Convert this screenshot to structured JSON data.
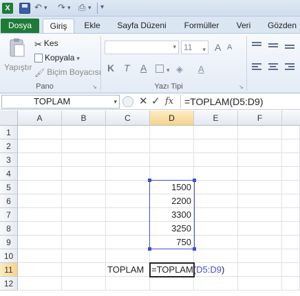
{
  "tabs": [
    "Dosya",
    "Giriş",
    "Ekle",
    "Sayfa Düzeni",
    "Formüller",
    "Veri",
    "Gözden"
  ],
  "clipboard": {
    "paste_label": "Yapıştır",
    "cut_label": "Kes",
    "copy_label": "Kopyala",
    "format_painter_label": "Biçim Boyacısı",
    "group_label": "Pano"
  },
  "font": {
    "size_value": "11",
    "group_label": "Yazı Tipi",
    "bold": "K",
    "italic": "T",
    "underline": "A",
    "grow": "A",
    "shrink": "A"
  },
  "name_box": "TOPLAM",
  "formula_bar": {
    "cancel": "✕",
    "enter": "✓",
    "fx": "fx",
    "formula": "=TOPLAM(D5:D9)"
  },
  "columns": [
    "A",
    "B",
    "C",
    "D",
    "E",
    "F"
  ],
  "rows": [
    "1",
    "2",
    "3",
    "4",
    "5",
    "6",
    "7",
    "8",
    "9",
    "10",
    "11",
    "12"
  ],
  "cells": {
    "D5": "1500",
    "D6": "2200",
    "D7": "3300",
    "D8": "3250",
    "D9": "750",
    "C11": "TOPLAM"
  },
  "edit_cell": {
    "prefix": "=TOPLAM(",
    "range": "D5:D9",
    "suffix": ")"
  },
  "colors": {
    "ribbon_tab_file": "#1f7a38",
    "range_border": "#3a4fd0",
    "header_active": "#f6d38a"
  }
}
